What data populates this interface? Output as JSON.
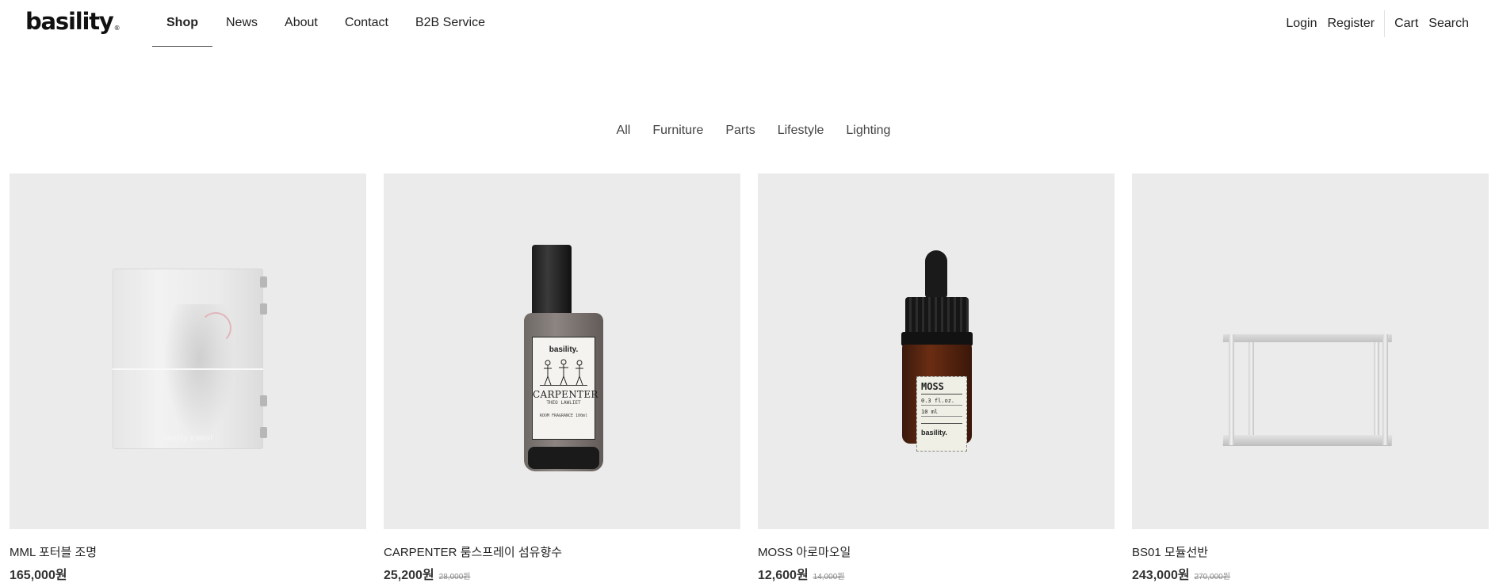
{
  "header": {
    "logo": "basility",
    "logo_mark": "®",
    "nav": [
      {
        "label": "Shop",
        "active": true
      },
      {
        "label": "News"
      },
      {
        "label": "About"
      },
      {
        "label": "Contact"
      },
      {
        "label": "B2B Service"
      }
    ],
    "utility": {
      "login": "Login",
      "register": "Register",
      "cart": "Cart",
      "search": "Search"
    }
  },
  "categories": [
    "All",
    "Furniture",
    "Parts",
    "Lifestyle",
    "Lighting"
  ],
  "products": [
    {
      "name": "MML 포터블 조명",
      "price": "165,000원",
      "original_price": "",
      "image_text": "basility x stoxl"
    },
    {
      "name": "CARPENTER 룸스프레이 섬유향수",
      "price": "25,200원",
      "original_price": "28,000원",
      "image_label": {
        "brand": "basility.",
        "title": "CARPENTER",
        "subtitle": "THEO LAWLIET",
        "volume": "ROOM FRAGRANCE 100ml"
      }
    },
    {
      "name": "MOSS 아로마오일",
      "price": "12,600원",
      "original_price": "14,000원",
      "image_label": {
        "title": "MOSS",
        "line1": "0.3 fl.oz.",
        "line2": "10 ml",
        "brand": "basility."
      }
    },
    {
      "name": "BS01 모듈선반",
      "price": "243,000원",
      "original_price": "270,000원"
    }
  ],
  "colors": {
    "background": "#ffffff",
    "thumb_background": "#ebebeb",
    "text": "#222222",
    "muted": "#888888"
  }
}
